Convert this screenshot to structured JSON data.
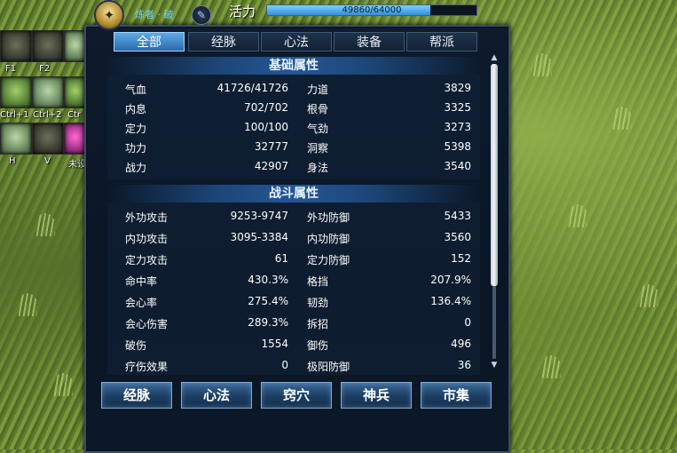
{
  "skillbar": {
    "keys": [
      "F1",
      "F2",
      "Ctrl+1",
      "Ctrl+2",
      "Ctr",
      "H",
      "V",
      "未设"
    ]
  },
  "header": {
    "emblem_icon": "scroll-emblem-icon",
    "rank": "炼者 · 破",
    "vitality_label": "活力",
    "vitality_text": "49860/64000",
    "vitality_fraction": 0.779
  },
  "tabs": [
    {
      "label": "全部",
      "active": true
    },
    {
      "label": "经脉",
      "active": false
    },
    {
      "label": "心法",
      "active": false
    },
    {
      "label": "装备",
      "active": false
    },
    {
      "label": "帮派",
      "active": false
    }
  ],
  "sections": {
    "basic": {
      "title": "基础属性",
      "rows": [
        {
          "l_name": "气血",
          "l_val": "41726/41726",
          "r_name": "力道",
          "r_val": "3829"
        },
        {
          "l_name": "内息",
          "l_val": "702/702",
          "r_name": "根骨",
          "r_val": "3325"
        },
        {
          "l_name": "定力",
          "l_val": "100/100",
          "r_name": "气劲",
          "r_val": "3273"
        },
        {
          "l_name": "功力",
          "l_val": "32777",
          "r_name": "洞察",
          "r_val": "5398"
        },
        {
          "l_name": "战力",
          "l_val": "42907",
          "r_name": "身法",
          "r_val": "3540"
        }
      ]
    },
    "combat": {
      "title": "战斗属性",
      "rows": [
        {
          "l_name": "外功攻击",
          "l_val": "9253-9747",
          "r_name": "外功防御",
          "r_val": "5433"
        },
        {
          "l_name": "内功攻击",
          "l_val": "3095-3384",
          "r_name": "内功防御",
          "r_val": "3560"
        },
        {
          "l_name": "定力攻击",
          "l_val": "61",
          "r_name": "定力防御",
          "r_val": "152"
        },
        {
          "l_name": "命中率",
          "l_val": "430.3%",
          "r_name": "格挡",
          "r_val": "207.9%"
        },
        {
          "l_name": "会心率",
          "l_val": "275.4%",
          "r_name": "韧劲",
          "r_val": "136.4%"
        },
        {
          "l_name": "会心伤害",
          "l_val": "289.3%",
          "r_name": "拆招",
          "r_val": "0"
        },
        {
          "l_name": "破伤",
          "l_val": "1554",
          "r_name": "御伤",
          "r_val": "496"
        },
        {
          "l_name": "疗伤效果",
          "l_val": "0",
          "r_name": "极阳防御",
          "r_val": "36"
        }
      ]
    }
  },
  "bottom_buttons": [
    "经脉",
    "心法",
    "窍穴",
    "神兵",
    "市集"
  ],
  "colors": {
    "accent": "#5da9e6",
    "panel_bg": "#0d1b2c",
    "rank_text": "#6fd6ff"
  }
}
